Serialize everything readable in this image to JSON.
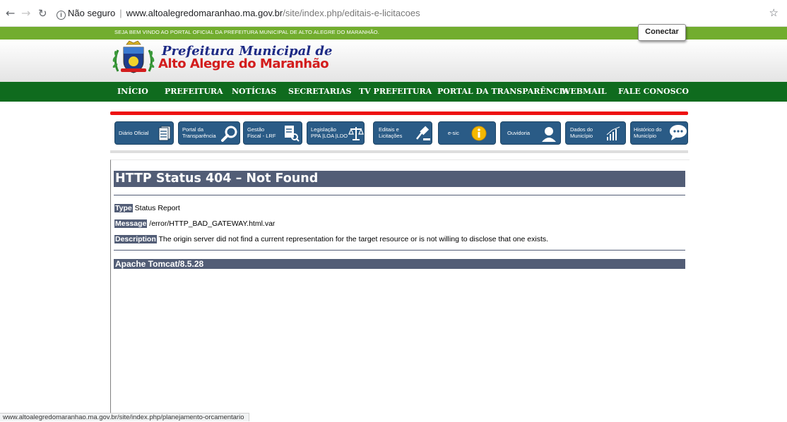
{
  "browser": {
    "security_label": "Não seguro",
    "url_host": "www.altoalegredomaranhao.ma.gov.br",
    "url_path": "/site/index.php/editais-e-licitacoes",
    "status_url": "www.altoalegredomaranhao.ma.gov.br/site/index.php/planejamento-orcamentario"
  },
  "topbar": {
    "welcome": "SEJA BEM VINDO AO PORTAL OFICIAL DA PREFEITURA MUNICIPAL DE ALTO ALEGRE DO MARANHÃO.",
    "connect_label": "Conectar"
  },
  "logo": {
    "line1": "Prefeitura Municipal de",
    "line2": "Alto Alegre do Maranhão"
  },
  "nav": [
    {
      "label": "INÍCIO"
    },
    {
      "label": "PREFEITURA"
    },
    {
      "label": "NOTÍCIAS"
    },
    {
      "label": "SECRETARIAS"
    },
    {
      "label": "TV PREFEITURA"
    },
    {
      "label": "PORTAL DA TRANSPARÊNCIA"
    },
    {
      "label": "WEBMAIL"
    },
    {
      "label": "FALE CONOSCO"
    }
  ],
  "quick_links": [
    {
      "l1": "Diário Oficial",
      "l2": "",
      "icon": "document-icon"
    },
    {
      "l1": "Portal da",
      "l2": "Transparência",
      "icon": "magnifier-icon"
    },
    {
      "l1": "Gestão",
      "l2": "Fiscal - LRF",
      "icon": "search-document-icon"
    },
    {
      "l1": "Legislação",
      "l2": "PPA |LOA |LDO",
      "icon": "scales-icon"
    },
    {
      "l1": "Editais e",
      "l2": "Licitações",
      "icon": "gavel-icon"
    },
    {
      "l1": "e-sic",
      "l2": "",
      "icon": "info-icon"
    },
    {
      "l1": "Ouvidoria",
      "l2": "",
      "icon": "person-icon"
    },
    {
      "l1": "Dados do",
      "l2": "Município",
      "icon": "bar-chart-icon"
    },
    {
      "l1": "Histórico do",
      "l2": "Município",
      "icon": "chat-bubble-icon"
    }
  ],
  "error": {
    "title": "HTTP Status 404 – Not Found",
    "type_label": "Type",
    "type_value": " Status Report",
    "message_label": "Message",
    "message_value": " /error/HTTP_BAD_GATEWAY.html.var",
    "description_label": "Description",
    "description_value": " The origin server did not find a current representation for the target resource or is not willing to disclose that one exists.",
    "server": "Apache Tomcat/8.5.28"
  },
  "colors": {
    "welcome_bar": "#72ad2f",
    "nav_bar": "#0f6b1e",
    "accent_rule": "#ee1111",
    "quick_button": "#2a5b86",
    "tomcat_header": "#525d76",
    "logo_blue": "#1d2a85",
    "logo_red": "#d31d1d"
  }
}
